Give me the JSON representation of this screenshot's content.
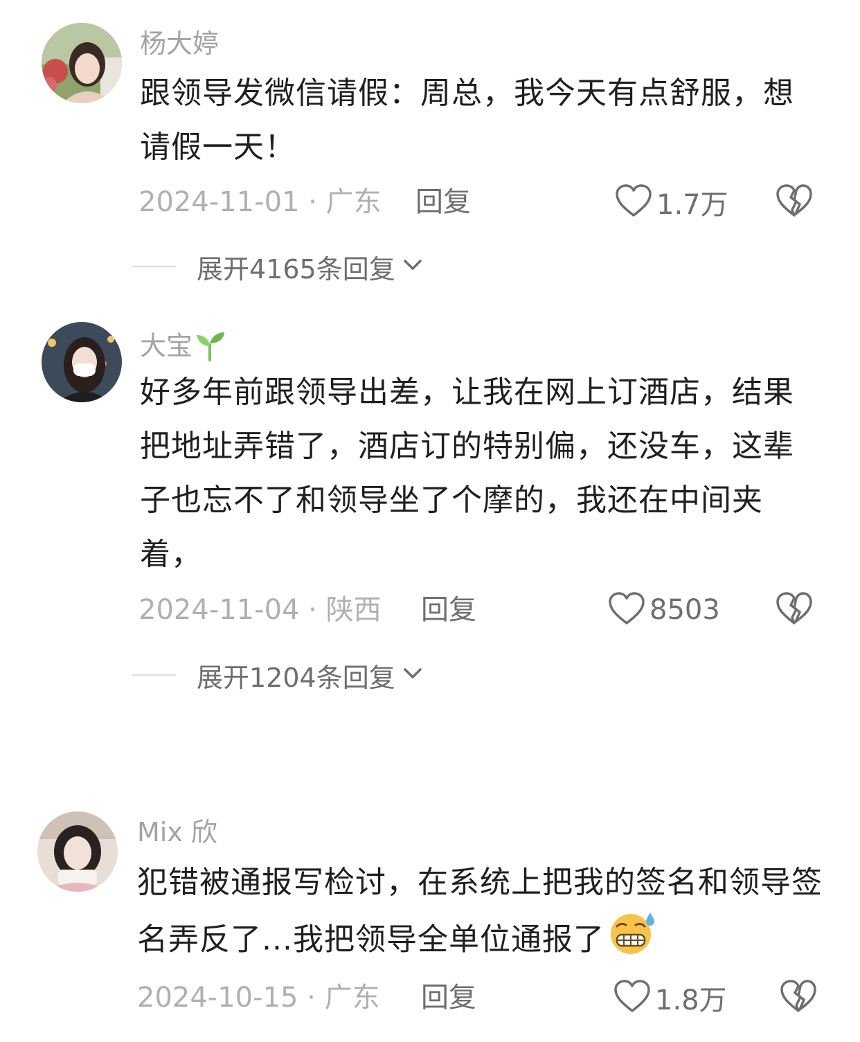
{
  "comments": [
    {
      "username": "杨大婷",
      "avatar_icon": "user-avatar-photo",
      "text": "跟领导发微信请假：周总，我今天有点舒服，想请假一天！",
      "date_location": "2024-11-01 · 广东",
      "reply_label": "回复",
      "likes": "1.7万",
      "expand_label": "展开4165条回复"
    },
    {
      "username": "大宝",
      "username_icon": "sprout-icon",
      "avatar_icon": "user-avatar-photo",
      "text": "好多年前跟领导出差，让我在网上订酒店，结果把地址弄错了，酒店订的特别偏，还没车，这辈子也忘不了和领导坐了个摩的，我还在中间夹着，",
      "date_location": "2024-11-04 · 陕西",
      "reply_label": "回复",
      "likes": "8503",
      "expand_label": "展开1204条回复"
    },
    {
      "username": "Mix 欣",
      "avatar_icon": "user-avatar-photo",
      "text": "犯错被通报写检讨，在系统上把我的签名和领导签名弄反了...我把领导全单位通报了",
      "text_emoji_icon": "grimacing-sweat-emoji-icon",
      "date_location": "2024-10-15 · 广东",
      "reply_label": "回复",
      "likes": "1.8万"
    }
  ],
  "colors": {
    "username": "#a3a3a3",
    "body_text": "#1f1f1f",
    "meta_text": "#b0b0b0",
    "action_text": "#6e6e6e"
  }
}
